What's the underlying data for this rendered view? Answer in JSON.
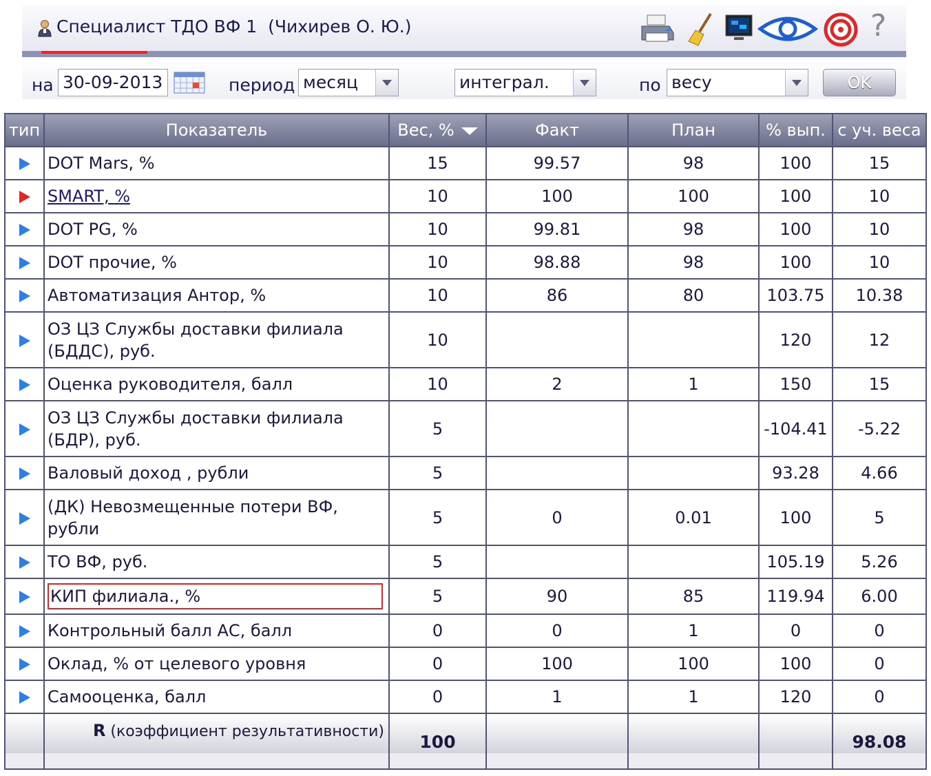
{
  "header": {
    "title": "Специалист ТДО ВФ 1  (Чихирев О. Ю.)",
    "help_glyph": "?",
    "icons": [
      "user-icon",
      "printer-icon",
      "broom-icon",
      "monitor-icon",
      "eye-icon",
      "target-icon",
      "help-icon"
    ],
    "progress": 0.12
  },
  "filters": {
    "date_label": "на",
    "date_value": "30-09-2013",
    "period_label": "период",
    "period_value": "месяц",
    "mode_value": "интеграл.",
    "by_label": "по",
    "by_value": "весу",
    "ok_label": "OK"
  },
  "table": {
    "columns": [
      "тип",
      "Показатель",
      "Вес, %",
      "Факт",
      "План",
      "% вып.",
      "с уч. веса"
    ],
    "rows": [
      {
        "name": "DOT Mars, %",
        "weight": "15",
        "fact": "99.57",
        "plan": "98",
        "pct": "100",
        "weighted": "15"
      },
      {
        "name": "SMART, %",
        "weight": "10",
        "fact": "100",
        "plan": "100",
        "pct": "100",
        "weighted": "10"
      },
      {
        "name": "DOT PG, %",
        "weight": "10",
        "fact": "99.81",
        "plan": "98",
        "pct": "100",
        "weighted": "10"
      },
      {
        "name": "DOT прочие, %",
        "weight": "10",
        "fact": "98.88",
        "plan": "98",
        "pct": "100",
        "weighted": "10"
      },
      {
        "name": "Автоматизация Антор, %",
        "weight": "10",
        "fact": "86",
        "plan": "80",
        "pct": "103.75",
        "weighted": "10.38"
      },
      {
        "name": "ОЗ ЦЗ Службы доставки филиала (БДДС), руб.",
        "weight": "10",
        "fact": "",
        "plan": "",
        "pct": "120",
        "weighted": "12"
      },
      {
        "name": "Оценка руководителя, балл",
        "weight": "10",
        "fact": "2",
        "plan": "1",
        "pct": "150",
        "weighted": "15"
      },
      {
        "name": "ОЗ ЦЗ Службы доставки филиала (БДР), руб.",
        "weight": "5",
        "fact": "",
        "plan": "",
        "pct": "-104.41",
        "weighted": "-5.22"
      },
      {
        "name": "Валовый доход , рубли",
        "weight": "5",
        "fact": "",
        "plan": "",
        "pct": "93.28",
        "weighted": "4.66"
      },
      {
        "name": "(ДК) Невозмещенные потери ВФ, рубли",
        "weight": "5",
        "fact": "0",
        "plan": "0.01",
        "pct": "100",
        "weighted": "5"
      },
      {
        "name": "ТО ВФ, руб.",
        "weight": "5",
        "fact": "",
        "plan": "",
        "pct": "105.19",
        "weighted": "5.26"
      },
      {
        "name": "КИП филиала., %",
        "weight": "5",
        "fact": "90",
        "plan": "85",
        "pct": "119.94",
        "weighted": "6.00"
      },
      {
        "name": "Контрольный балл АС, балл",
        "weight": "0",
        "fact": "0",
        "plan": "1",
        "pct": "0",
        "weighted": "0"
      },
      {
        "name": "Оклад, % от целевого уровня",
        "weight": "0",
        "fact": "100",
        "plan": "100",
        "pct": "100",
        "weighted": "0"
      },
      {
        "name": "Самооценка, балл",
        "weight": "0",
        "fact": "1",
        "plan": "1",
        "pct": "120",
        "weighted": "0"
      }
    ],
    "total": {
      "label_bold": "R",
      "label": " (коэффициент результативности)",
      "weight_sum": "100",
      "weighted_sum": "98.08"
    }
  },
  "colors": {
    "accent_blue": "#2f7fe2",
    "accent_red": "#e02626",
    "header_grad_top": "#9ea1b5",
    "header_grad_bottom": "#6a6e8b",
    "border": "#4f5378"
  }
}
